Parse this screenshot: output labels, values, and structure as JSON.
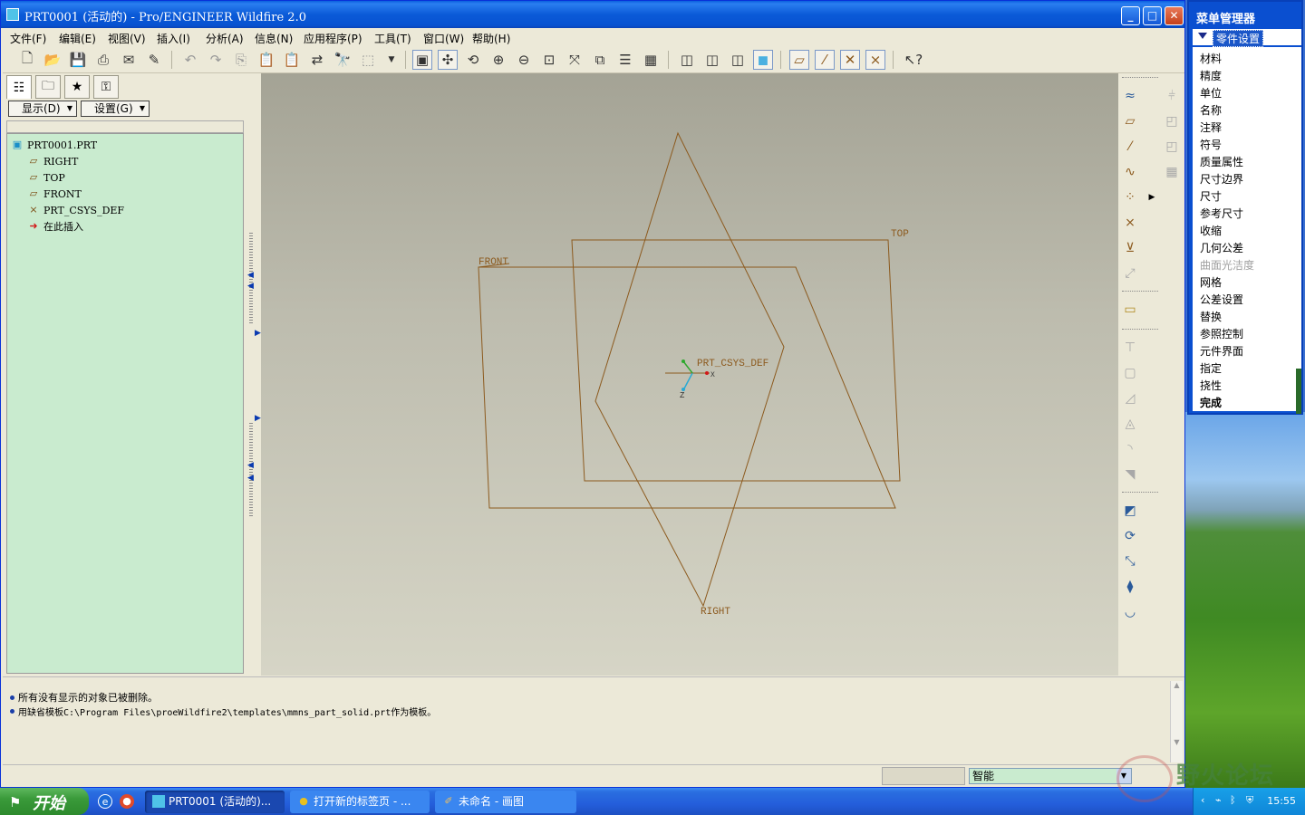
{
  "window": {
    "title": "PRT0001 (活动的) - Pro/ENGINEER Wildfire 2.0",
    "controls": {
      "minimize": "_",
      "maximize": "□",
      "close": "✕"
    }
  },
  "menubar": {
    "items": [
      "文件(F)",
      "编辑(E)",
      "视图(V)",
      "插入(I)",
      "分析(A)",
      "信息(N)",
      "应用程序(P)",
      "工具(T)",
      "窗口(W)",
      "帮助(H)"
    ]
  },
  "toolbar": {
    "icons": [
      "new-file-icon",
      "open-file-icon",
      "save-icon",
      "print-icon",
      "send-icon",
      "edit-icon",
      "undo-icon",
      "redo-icon",
      "copy-icon",
      "paste-icon",
      "paste-special-icon",
      "regenerate-icon",
      "find-icon",
      "select-box-icon",
      "dropdown-arrow-icon",
      "repaint-icon",
      "spin-center-icon",
      "orient-icon",
      "zoom-in-icon",
      "zoom-out-icon",
      "refit-icon",
      "reorient-icon",
      "saved-views-icon",
      "layers-icon",
      "view-manager-icon",
      "wireframe-icon",
      "hidden-line-icon",
      "no-hidden-icon",
      "shading-icon",
      "datum-planes-icon",
      "datum-axes-icon",
      "datum-points-icon",
      "csys-icon",
      "context-help-icon"
    ]
  },
  "left_panel": {
    "display_button": "显示(D)",
    "settings_button": "设置(G)",
    "tree": [
      {
        "label": "PRT0001.PRT",
        "icon": "part-icon"
      },
      {
        "label": "RIGHT",
        "icon": "datum-plane-icon"
      },
      {
        "label": "TOP",
        "icon": "datum-plane-icon"
      },
      {
        "label": "FRONT",
        "icon": "datum-plane-icon"
      },
      {
        "label": "PRT_CSYS_DEF",
        "icon": "csys-icon"
      },
      {
        "label": "在此插入",
        "icon": "insert-here-arrow-icon"
      }
    ]
  },
  "graphics": {
    "labels": {
      "front": "FRONT",
      "top": "TOP",
      "right": "RIGHT",
      "csys": "PRT_CSYS_DEF",
      "axis_z": "Z",
      "axis_x": "X"
    },
    "datum_color": "#8c5a1e"
  },
  "messages": [
    "所有没有显示的对象已被删除。",
    "用缺省模板C:\\Program Files\\proeWildfire2\\templates\\mmns_part_solid.prt作为模板。"
  ],
  "statusbar": {
    "filter": "智能"
  },
  "menu_manager": {
    "title": "菜单管理器",
    "section": "零件设置",
    "items": [
      {
        "label": "材料",
        "state": "normal"
      },
      {
        "label": "精度",
        "state": "normal"
      },
      {
        "label": "单位",
        "state": "normal"
      },
      {
        "label": "名称",
        "state": "normal"
      },
      {
        "label": "注释",
        "state": "normal"
      },
      {
        "label": "符号",
        "state": "normal"
      },
      {
        "label": "质量属性",
        "state": "normal"
      },
      {
        "label": "尺寸边界",
        "state": "normal"
      },
      {
        "label": "尺寸",
        "state": "normal"
      },
      {
        "label": "参考尺寸",
        "state": "normal"
      },
      {
        "label": "收缩",
        "state": "normal"
      },
      {
        "label": "几何公差",
        "state": "normal"
      },
      {
        "label": "曲面光洁度",
        "state": "disabled"
      },
      {
        "label": "网格",
        "state": "normal"
      },
      {
        "label": "公差设置",
        "state": "normal"
      },
      {
        "label": "替换",
        "state": "normal"
      },
      {
        "label": "参照控制",
        "state": "normal"
      },
      {
        "label": "元件界面",
        "state": "normal"
      },
      {
        "label": "指定",
        "state": "normal"
      },
      {
        "label": "挠性",
        "state": "normal"
      },
      {
        "label": "完成",
        "state": "bold"
      }
    ]
  },
  "taskbar": {
    "start": "开始",
    "tasks": [
      {
        "label": "PRT0001 (活动的)...",
        "icon": "proe-icon",
        "active": true
      },
      {
        "label": "打开新的标签页 - ...",
        "icon": "chrome-icon",
        "active": false
      },
      {
        "label": "未命名 - 画图",
        "icon": "paint-icon",
        "active": false
      }
    ],
    "clock": "15:55"
  },
  "watermark": {
    "text": "野火论坛"
  }
}
